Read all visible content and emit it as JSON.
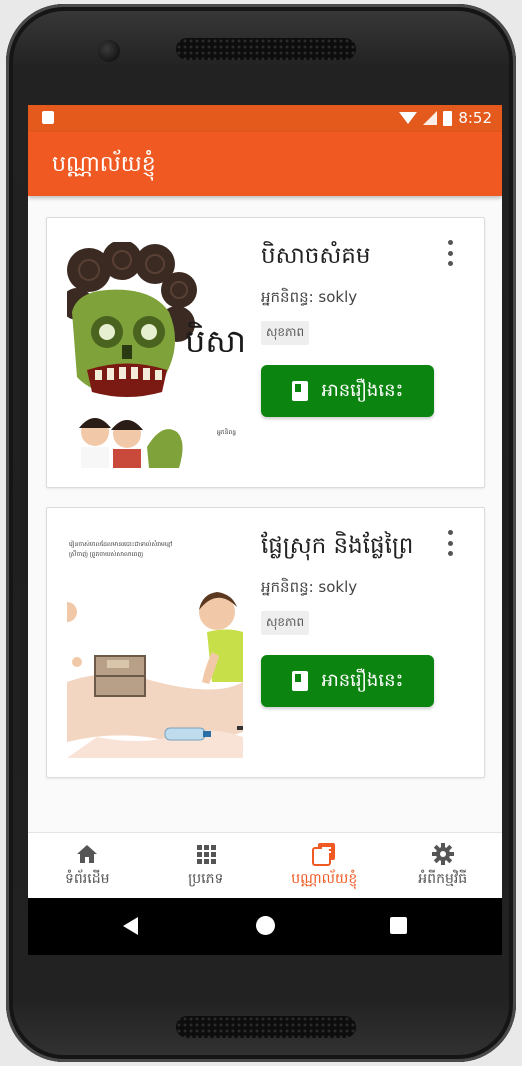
{
  "status_bar": {
    "time": "8:52"
  },
  "app_bar": {
    "title": "បណ្ណាល័យខ្ញុំ"
  },
  "books": [
    {
      "title": "បិសាចសំគម",
      "author": "អ្នកនិពន្ធ: sokly",
      "category": "សុខភាព",
      "read_label": "អានរឿងនេះ",
      "cover_text": "បិសា សំគ",
      "cover_small": "អ្នកនិពន្ធ"
    },
    {
      "title": "ផ្លែស្រុក និងផ្លែព្រៃ",
      "author": "អ្នកនិពន្ធ: sokly",
      "category": "សុខភាព",
      "read_label": "អានរឿងនេះ",
      "cover_text": "រៀនចាស់ចេលដែលមានរបោះជាទាល់សំរាមខ្មៅ",
      "cover_small": "ស្រីចាញ់ ព្រួតចាយស់សាលាពេញ"
    }
  ],
  "bottom_nav": [
    {
      "label": "ទំព័រដើម",
      "icon": "home-icon"
    },
    {
      "label": "ប្រភេទ",
      "icon": "grid-icon"
    },
    {
      "label": "បណ្ណាល័យខ្ញុំ",
      "icon": "library-icon"
    },
    {
      "label": "អំពីកម្មវិធី",
      "icon": "gear-icon"
    }
  ],
  "colors": {
    "accent": "#f05a22",
    "button": "#0c8410"
  }
}
